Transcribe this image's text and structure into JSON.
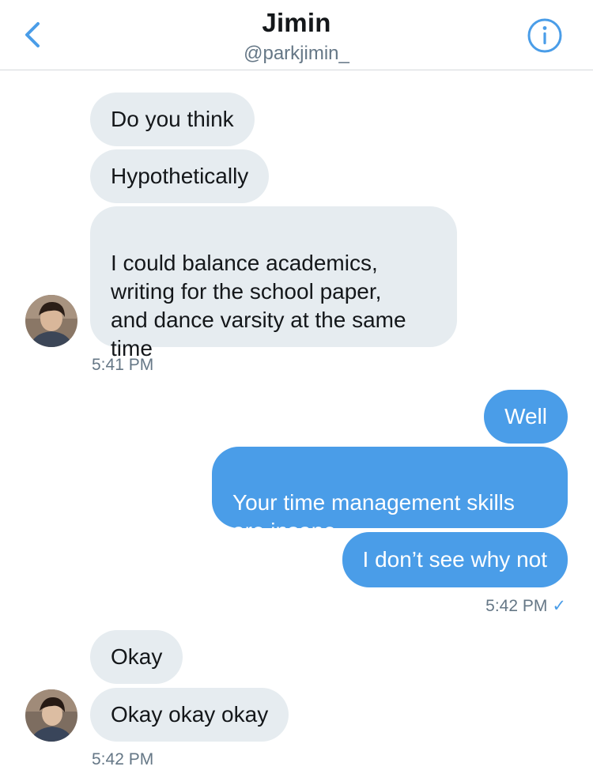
{
  "header": {
    "title": "Jimin",
    "handle": "@parkjimin_",
    "back_icon": "chevron-left-icon",
    "info_icon": "info-icon",
    "accent": "#4a9de8"
  },
  "messages": [
    {
      "text": "Do you think",
      "direction": "received"
    },
    {
      "text": "Hypothetically",
      "direction": "received"
    },
    {
      "text": "I could balance academics,\nwriting for the school paper,\nand dance varsity at the same\ntime",
      "direction": "received"
    },
    {
      "text": "Well",
      "direction": "sent"
    },
    {
      "text": "Your time management skills\nare insane",
      "direction": "sent"
    },
    {
      "text": "I don’t see why not",
      "direction": "sent"
    },
    {
      "text": "Okay",
      "direction": "received"
    },
    {
      "text": "Okay okay okay",
      "direction": "received"
    }
  ],
  "timestamps": {
    "group1": "5:41 PM",
    "group2": "5:42 PM",
    "group3": "5:42 PM"
  },
  "read_receipt_icon": "checkmark-icon",
  "colors": {
    "received_bubble": "#e6ecf0",
    "sent_bubble": "#4a9de8",
    "timestamp": "#657786"
  }
}
